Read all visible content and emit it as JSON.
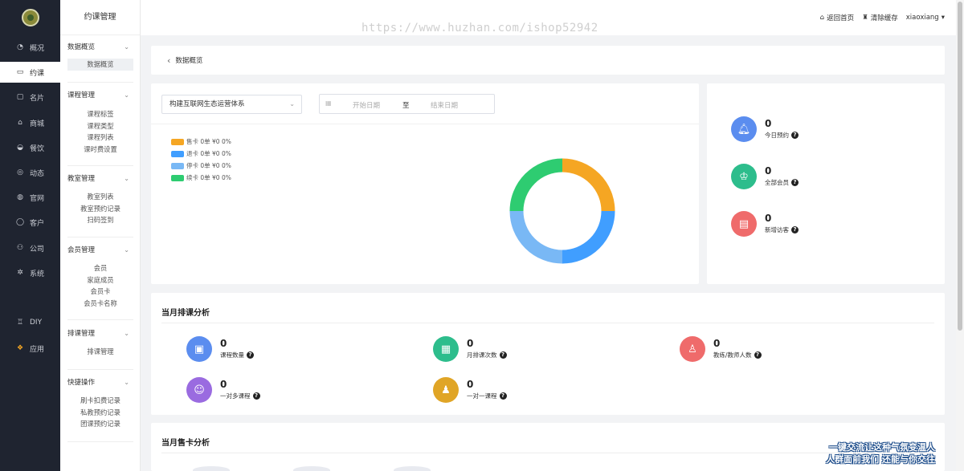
{
  "nav": {
    "items": [
      {
        "label": "概况",
        "icon": "dashboard-icon"
      },
      {
        "label": "约课",
        "icon": "calendar-icon",
        "active": true
      },
      {
        "label": "名片",
        "icon": "card-icon"
      },
      {
        "label": "商城",
        "icon": "shop-icon"
      },
      {
        "label": "餐饮",
        "icon": "food-icon"
      },
      {
        "label": "动态",
        "icon": "compass-icon"
      },
      {
        "label": "官网",
        "icon": "globe-icon"
      },
      {
        "label": "客户",
        "icon": "user-icon"
      },
      {
        "label": "公司",
        "icon": "company-icon"
      },
      {
        "label": "系统",
        "icon": "gear-icon"
      },
      {
        "label": "DIY",
        "icon": "diy-icon"
      },
      {
        "label": "应用",
        "icon": "apps-icon"
      }
    ]
  },
  "sidebar": {
    "title": "约课管理",
    "groups": [
      {
        "label": "数据概览",
        "items": [
          "数据概览"
        ]
      },
      {
        "label": "课程管理",
        "items": [
          "课程标签",
          "课程类型",
          "课程列表",
          "课时费设置"
        ]
      },
      {
        "label": "教室管理",
        "items": [
          "教室列表",
          "教室预约记录",
          "扫码签到"
        ]
      },
      {
        "label": "会员管理",
        "items": [
          "会员",
          "家庭成员",
          "会员卡",
          "会员卡名称"
        ]
      },
      {
        "label": "排课管理",
        "items": [
          "排课管理"
        ]
      },
      {
        "label": "快捷操作",
        "items": [
          "刷卡扣费记录",
          "私教预约记录",
          "团课预约记录"
        ]
      }
    ]
  },
  "header": {
    "watermark": "https://www.huzhan.com/ishop52942",
    "home_link": "返回首页",
    "clear_cache": "清除缓存",
    "username": "xiaoxiang"
  },
  "breadcrumb": {
    "label": "数据概览"
  },
  "filters": {
    "system_select": "构建互联网生态运营体系",
    "start_placeholder": "开始日期",
    "range_sep": "至",
    "end_placeholder": "结束日期"
  },
  "chart_data": {
    "type": "pie",
    "series": [
      {
        "name": "售卡 0单 ¥0 0%",
        "value": 0,
        "color": "#f5a623"
      },
      {
        "name": "退卡 0单 ¥0 0%",
        "value": 0,
        "color": "#409eff"
      },
      {
        "name": "停卡 0单 ¥0 0%",
        "value": 0,
        "color": "#79b8f5"
      },
      {
        "name": "续卡 0单 ¥0 0%",
        "value": 0,
        "color": "#2ecc71"
      }
    ]
  },
  "overview": [
    {
      "value": "0",
      "label": "今日预约",
      "color": "#5b8def",
      "icon": "bell-icon"
    },
    {
      "value": "0",
      "label": "全部会员",
      "color": "#2dbd8c",
      "icon": "crown-icon"
    },
    {
      "value": "0",
      "label": "新增访客",
      "color": "#ef6b6b",
      "icon": "id-card-icon"
    }
  ],
  "monthly": {
    "title": "当月排课分析",
    "stats": [
      {
        "value": "0",
        "label": "课程数量",
        "color": "#5b8def",
        "icon": "book-icon"
      },
      {
        "value": "0",
        "label": "月排课次数",
        "color": "#2dbd8c",
        "icon": "calendar-grid-icon"
      },
      {
        "value": "0",
        "label": "教练/教师人数",
        "color": "#ef6b6b",
        "icon": "teacher-icon"
      },
      {
        "value": "0",
        "label": "一对多课程",
        "color": "#9a6be0",
        "icon": "group-icon"
      },
      {
        "value": "0",
        "label": "一对一课程",
        "color": "#e0a526",
        "icon": "person-icon"
      }
    ]
  },
  "sales": {
    "title": "当月售卡分析"
  },
  "badge": {
    "line1": "一键交流让这种气氛变温人",
    "line2": "人群面前我们 还能与你交往"
  }
}
